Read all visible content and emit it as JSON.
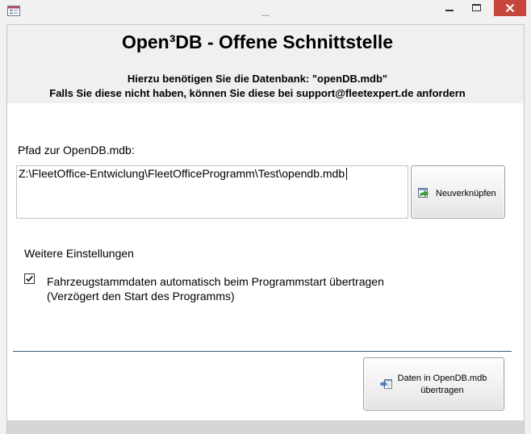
{
  "window": {
    "title": "...",
    "icon": "access-form-icon"
  },
  "header": {
    "title": "Open³DB - Offene Schnittstelle",
    "line1": "Hierzu benötigen Sie die Datenbank: \"openDB.mdb\"",
    "line2": "Falls Sie diese nicht haben, können Sie diese bei support@fleetexpert.de anfordern"
  },
  "path": {
    "label": "Pfad zur OpenDB.mdb:",
    "value": "Z:\\FleetOffice-Entwiclung\\FleetOfficeProgramm\\Test\\opendb.mdb"
  },
  "relink_button": {
    "label": "Neuverknüpfen",
    "icon": "relink-icon"
  },
  "settings": {
    "heading": "Weitere Einstellungen",
    "auto_transfer": {
      "checked": true,
      "label_line1": "Fahrzeugstammdaten automatisch beim Programmstart übertragen",
      "label_line2": "(Verzögert den Start des Programms)"
    }
  },
  "transfer_button": {
    "label_line1": "Daten in OpenDB.mdb",
    "label_line2": "übertragen",
    "icon": "transfer-icon"
  },
  "colors": {
    "close_button": "#c7463c",
    "divider": "#3d5b7a"
  }
}
